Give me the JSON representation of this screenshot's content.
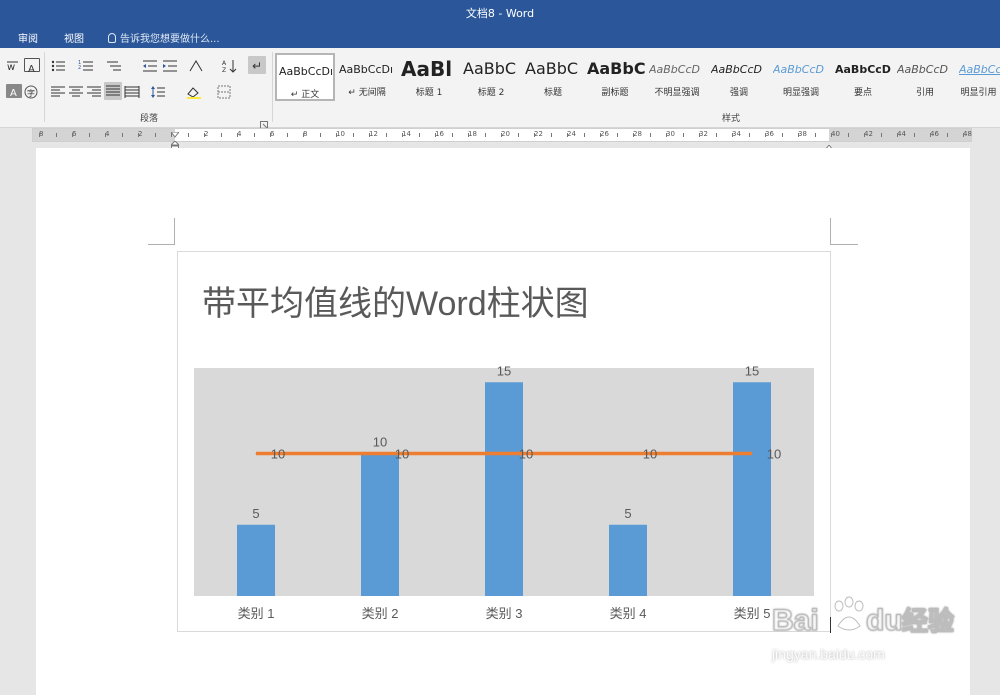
{
  "window": {
    "title": "文档8 - Word"
  },
  "tabs": {
    "review": "审阅",
    "view": "视图"
  },
  "tell_me": {
    "placeholder": "告诉我您想要做什么..."
  },
  "ribbon": {
    "paragraph_label": "段落",
    "styles_label": "样式",
    "styles": [
      {
        "preview": "AaBbCcDı",
        "name": "↵ 正文",
        "selected": true
      },
      {
        "preview": "AaBbCcDı",
        "name": "↵ 无间隔"
      },
      {
        "preview": "AaBl",
        "name": "标题 1"
      },
      {
        "preview": "AaBbC",
        "name": "标题 2"
      },
      {
        "preview": "AaBbC",
        "name": "标题"
      },
      {
        "preview": "AaBbC",
        "name": "副标题"
      },
      {
        "preview": "AaBbCcD",
        "name": "不明显强调"
      },
      {
        "preview": "AaBbCcD",
        "name": "强调"
      },
      {
        "preview": "AaBbCcD",
        "name": "明显强调"
      },
      {
        "preview": "AaBbCcD",
        "name": "要点"
      },
      {
        "preview": "AaBbCcD",
        "name": "引用"
      },
      {
        "preview": "AaBbCcD",
        "name": "明显引用"
      }
    ]
  },
  "ruler": {
    "labels": [
      "8",
      "6",
      "4",
      "2",
      "2",
      "4",
      "6",
      "8",
      "10",
      "12",
      "14",
      "16",
      "18",
      "20",
      "22",
      "24",
      "26",
      "28",
      "30",
      "32",
      "34",
      "36",
      "38",
      "40",
      "42",
      "44",
      "46",
      "48"
    ]
  },
  "chart_data": {
    "type": "bar",
    "title": "带平均值线的Word柱状图",
    "categories": [
      "类别 1",
      "类别 2",
      "类别 3",
      "类别 4",
      "类别 5"
    ],
    "series": [
      {
        "values": [
          5,
          10,
          15,
          5,
          15
        ],
        "color": "#5b9bd5",
        "type": "bar"
      },
      {
        "values": [
          10,
          10,
          10,
          10,
          10
        ],
        "color": "#ed7d31",
        "type": "line"
      }
    ],
    "ylim": [
      0,
      16
    ],
    "grid": false,
    "legend": "none",
    "plot_background": "#d9d9d9"
  },
  "watermark": {
    "logo": "Bai du 经验",
    "url": "jingyan.baidu.com"
  }
}
